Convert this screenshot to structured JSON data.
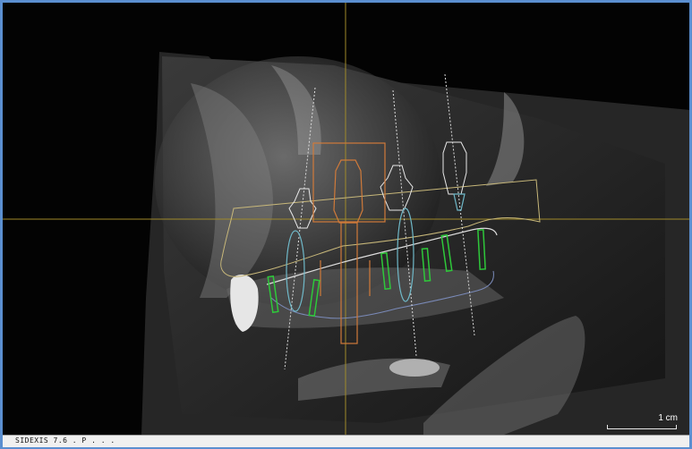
{
  "status_bar": {
    "text": "SIDEXIS 7.6 . P . . ."
  },
  "scale_bar": {
    "label": "1 cm"
  },
  "colors": {
    "frame": "#5b8fd0",
    "crosshair": "#a08a2a",
    "implant_outline": "#e8e8e8",
    "selected_implant": "#d07a3a",
    "nerve_canal": "#6fb8c8",
    "tooth_markers": "#2ec83a",
    "bone_contour": "#c8b87a",
    "soft_tissue_contour": "#7a8ab8"
  },
  "icons": [
    "implant-icon",
    "crosshair-icon"
  ]
}
